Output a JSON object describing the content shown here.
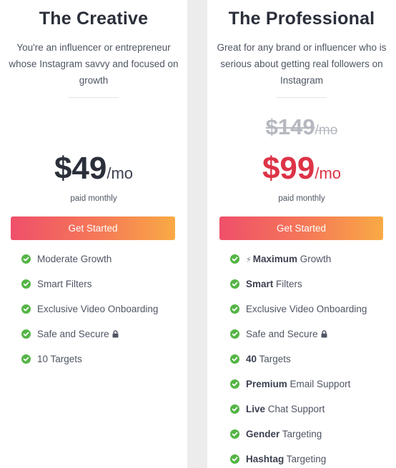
{
  "plans": {
    "creative": {
      "title": "The Creative",
      "description": "You're an influencer or entrepreneur whose Instagram savvy and focused on growth",
      "price_amount": "$49",
      "price_period": "/mo",
      "billing": "paid monthly",
      "cta_label": "Get Started",
      "features": [
        {
          "bold": "",
          "text": "Moderate Growth"
        },
        {
          "bold": "",
          "text": "Smart Filters"
        },
        {
          "bold": "",
          "text": "Exclusive Video Onboarding"
        },
        {
          "bold": "",
          "text": "Safe and Secure"
        },
        {
          "bold": "",
          "text": "10 Targets"
        }
      ]
    },
    "professional": {
      "title": "The Professional",
      "description": "Great for any brand or influencer who is serious about getting real followers on Instagram",
      "old_price_amount": "$149",
      "old_price_period": "/mo",
      "price_amount": "$99",
      "price_period": "/mo",
      "billing": "paid monthly",
      "cta_label": "Get Started",
      "features": [
        {
          "bold": "Maximum",
          "text": " Growth"
        },
        {
          "bold": "Smart",
          "text": " Filters"
        },
        {
          "bold": "",
          "text": "Exclusive Video Onboarding"
        },
        {
          "bold": "",
          "text": "Safe and Secure"
        },
        {
          "bold": "40",
          "text": " Targets"
        },
        {
          "bold": "Premium",
          "text": " Email Support"
        },
        {
          "bold": "Live",
          "text": " Chat Support"
        },
        {
          "bold": "Gender",
          "text": " Targeting"
        },
        {
          "bold": "Hashtag",
          "text": " Targeting"
        }
      ]
    }
  },
  "icons": {
    "check": "check-circle-icon",
    "lock": "lock-icon",
    "bolt": "lightning-bolt-icon"
  },
  "colors": {
    "accent_red": "#dd3347",
    "check_green": "#54b545",
    "cta_gradient_start": "#ef4f6a",
    "cta_gradient_end": "#f9aa45",
    "strike_gray": "#b5b8bf"
  }
}
